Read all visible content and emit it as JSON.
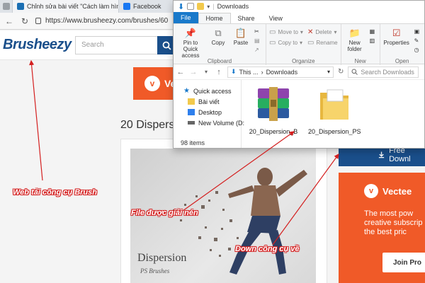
{
  "browser": {
    "tabs": [
      {
        "label": ""
      },
      {
        "label": "Chỉnh sửa bài viết \"Cách làm hìn"
      },
      {
        "label": "Facebook"
      }
    ],
    "url": "https://www.brusheezy.com/brushes/60"
  },
  "site": {
    "logo": "Brusheezy",
    "search_placeholder": "Search",
    "vecteezy_banner": "Vec",
    "page_heading": "20 Dispers",
    "preview_title": "Dispersion",
    "preview_subtitle": "PS Brushes",
    "free_download": "Free Downl",
    "promo": {
      "brand": "Vectee",
      "text": [
        "The most pow",
        "creative subscrip",
        "the best pric"
      ],
      "button": "Join Pro"
    }
  },
  "explorer": {
    "title": "Downloads",
    "tabs": [
      "File",
      "Home",
      "Share",
      "View"
    ],
    "clipboard": {
      "pin": "Pin to Quick access",
      "copy": "Copy",
      "paste": "Paste",
      "label": "Clipboard"
    },
    "organize": {
      "move_to": "Move to",
      "copy_to": "Copy to",
      "delete": "Delete",
      "rename": "Rename",
      "label": "Organize"
    },
    "new": {
      "new_folder": "New folder",
      "label": "New"
    },
    "open": {
      "properties": "Properties",
      "label": "Open"
    },
    "path": [
      "This ...",
      "Downloads"
    ],
    "search_placeholder": "Search Downloads",
    "nav_items": [
      "Quick access",
      "Bài viết",
      "Desktop",
      "New Volume (D:"
    ],
    "files": [
      "20_Dispersion_B",
      "20_Dispersion_PS"
    ],
    "status": "98 items"
  },
  "annotations": {
    "web_label": "Web tải công cụ Brush",
    "file_label": "File được giải nén",
    "down_label": "Down công cụ về"
  },
  "colors": {
    "brand_blue": "#1a4f8b",
    "vecteezy_orange": "#f05a28",
    "annotation_red": "#d41f1f",
    "explorer_blue": "#1979ca"
  }
}
